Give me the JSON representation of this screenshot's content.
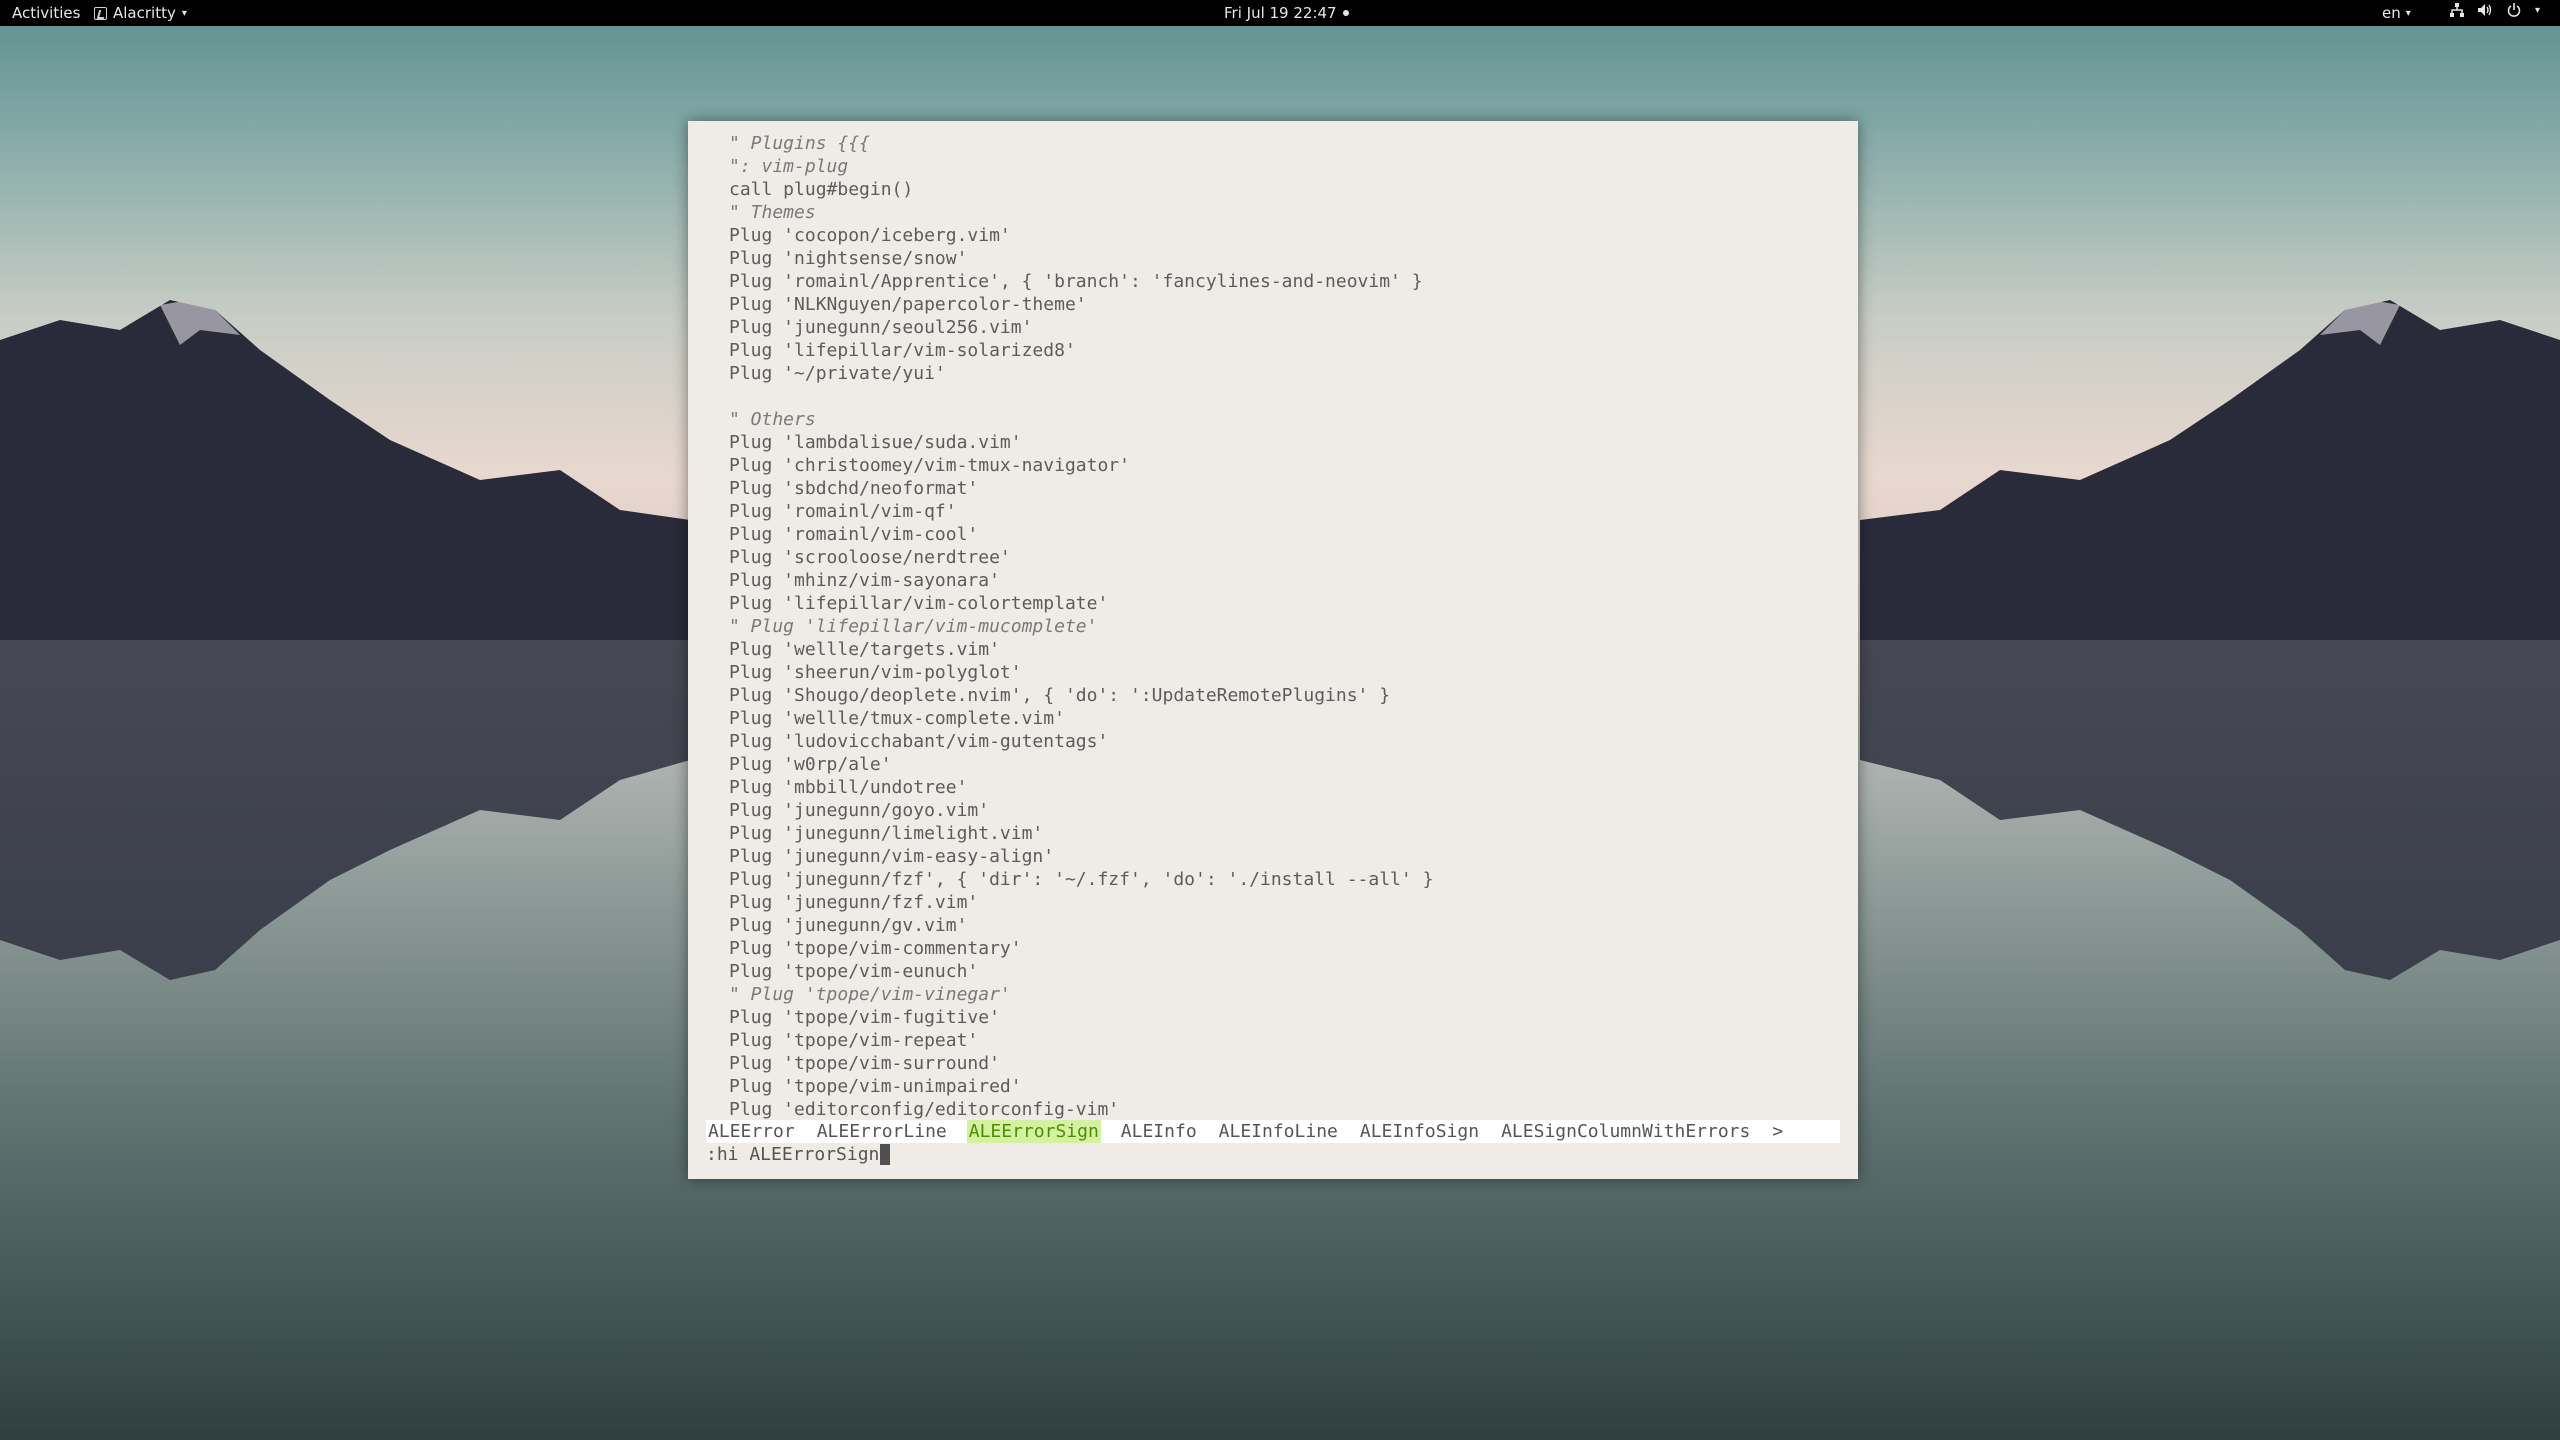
{
  "topbar": {
    "activities": "Activities",
    "app_name": "Alacritty",
    "clock": "Fri Jul 19  22:47",
    "language": "en",
    "tray_icons": [
      "network-icon",
      "volume-icon",
      "power-icon"
    ]
  },
  "terminal": {
    "lines": [
      {
        "kind": "comment",
        "text": "\" Plugins {{{"
      },
      {
        "kind": "comment",
        "text": "\": vim-plug"
      },
      {
        "kind": "code",
        "text": "call plug#begin()"
      },
      {
        "kind": "comment",
        "text": "\" Themes"
      },
      {
        "kind": "code",
        "text": "Plug 'cocopon/iceberg.vim'"
      },
      {
        "kind": "code",
        "text": "Plug 'nightsense/snow'"
      },
      {
        "kind": "code",
        "text": "Plug 'romainl/Apprentice', { 'branch': 'fancylines-and-neovim' }"
      },
      {
        "kind": "code",
        "text": "Plug 'NLKNguyen/papercolor-theme'"
      },
      {
        "kind": "code",
        "text": "Plug 'junegunn/seoul256.vim'"
      },
      {
        "kind": "code",
        "text": "Plug 'lifepillar/vim-solarized8'"
      },
      {
        "kind": "code",
        "text": "Plug '~/private/yui'"
      },
      {
        "kind": "blank",
        "text": ""
      },
      {
        "kind": "comment",
        "text": "\" Others"
      },
      {
        "kind": "code",
        "text": "Plug 'lambdalisue/suda.vim'"
      },
      {
        "kind": "code",
        "text": "Plug 'christoomey/vim-tmux-navigator'"
      },
      {
        "kind": "code",
        "text": "Plug 'sbdchd/neoformat'"
      },
      {
        "kind": "code",
        "text": "Plug 'romainl/vim-qf'"
      },
      {
        "kind": "code",
        "text": "Plug 'romainl/vim-cool'"
      },
      {
        "kind": "code",
        "text": "Plug 'scrooloose/nerdtree'"
      },
      {
        "kind": "code",
        "text": "Plug 'mhinz/vim-sayonara'"
      },
      {
        "kind": "code",
        "text": "Plug 'lifepillar/vim-colortemplate'"
      },
      {
        "kind": "comment",
        "text": "\" Plug 'lifepillar/vim-mucomplete'"
      },
      {
        "kind": "code",
        "text": "Plug 'wellle/targets.vim'"
      },
      {
        "kind": "code",
        "text": "Plug 'sheerun/vim-polyglot'"
      },
      {
        "kind": "code",
        "text": "Plug 'Shougo/deoplete.nvim', { 'do': ':UpdateRemotePlugins' }"
      },
      {
        "kind": "code",
        "text": "Plug 'wellle/tmux-complete.vim'"
      },
      {
        "kind": "code",
        "text": "Plug 'ludovicchabant/vim-gutentags'"
      },
      {
        "kind": "code",
        "text": "Plug 'w0rp/ale'"
      },
      {
        "kind": "code",
        "text": "Plug 'mbbill/undotree'"
      },
      {
        "kind": "code",
        "text": "Plug 'junegunn/goyo.vim'"
      },
      {
        "kind": "code",
        "text": "Plug 'junegunn/limelight.vim'"
      },
      {
        "kind": "code",
        "text": "Plug 'junegunn/vim-easy-align'"
      },
      {
        "kind": "code",
        "text": "Plug 'junegunn/fzf', { 'dir': '~/.fzf', 'do': './install --all' }"
      },
      {
        "kind": "code",
        "text": "Plug 'junegunn/fzf.vim'"
      },
      {
        "kind": "code",
        "text": "Plug 'junegunn/gv.vim'"
      },
      {
        "kind": "code",
        "text": "Plug 'tpope/vim-commentary'"
      },
      {
        "kind": "code",
        "text": "Plug 'tpope/vim-eunuch'"
      },
      {
        "kind": "comment",
        "text": "\" Plug 'tpope/vim-vinegar'"
      },
      {
        "kind": "code",
        "text": "Plug 'tpope/vim-fugitive'"
      },
      {
        "kind": "code",
        "text": "Plug 'tpope/vim-repeat'"
      },
      {
        "kind": "code",
        "text": "Plug 'tpope/vim-surround'"
      },
      {
        "kind": "code",
        "text": "Plug 'tpope/vim-unimpaired'"
      },
      {
        "kind": "code",
        "text": "Plug 'editorconfig/editorconfig-vim'"
      }
    ],
    "wildmenu": {
      "items": [
        "ALEError",
        "ALEErrorLine",
        "ALEErrorSign",
        "ALEInfo",
        "ALEInfoLine",
        "ALEInfoSign",
        "ALESignColumnWithErrors",
        ">"
      ],
      "selected_index": 2
    },
    "command_line": ":hi ALEErrorSign"
  },
  "colors": {
    "terminal_bg": "#efebe6",
    "wildmenu_selected_bg": "#d5f0a0",
    "wildmenu_selected_fg": "#4a8f00"
  }
}
